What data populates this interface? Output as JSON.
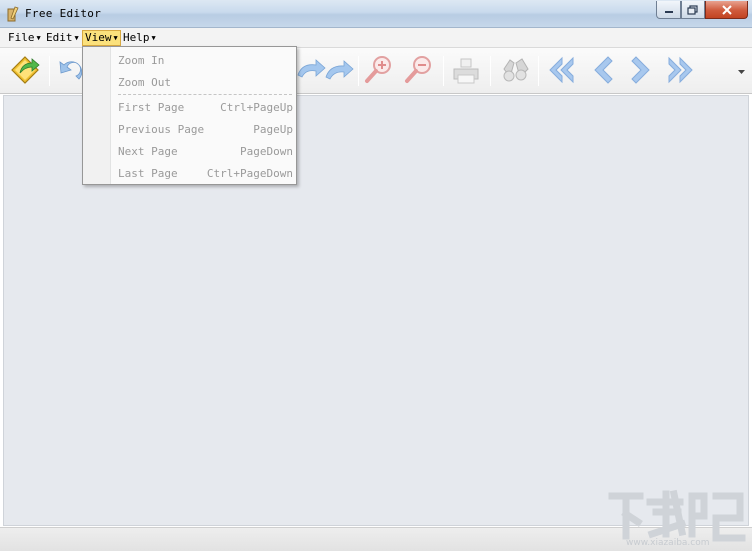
{
  "window": {
    "title": "Free Editor"
  },
  "menubar": {
    "items": [
      {
        "label": "File"
      },
      {
        "label": "Edit"
      },
      {
        "label": "View"
      },
      {
        "label": "Help"
      }
    ]
  },
  "view_menu": {
    "items": [
      {
        "label": "Zoom In",
        "shortcut": ""
      },
      {
        "label": "Zoom Out",
        "shortcut": ""
      },
      {
        "label": "First Page",
        "shortcut": "Ctrl+PageUp"
      },
      {
        "label": "Previous Page",
        "shortcut": "PageUp"
      },
      {
        "label": "Next Page",
        "shortcut": "PageDown"
      },
      {
        "label": "Last Page",
        "shortcut": "Ctrl+PageDown"
      }
    ]
  },
  "toolbar": {
    "icons": [
      "open-icon",
      "undo-icon",
      "redo-icon",
      "zoom-in-icon",
      "zoom-out-icon",
      "print-icon",
      "find-icon",
      "first-page-icon",
      "previous-page-icon",
      "next-page-icon",
      "last-page-icon"
    ]
  },
  "colors": {
    "workspace": "#e6e9ee",
    "menu_active": "#fbe17c",
    "nav_arrow": "#8fb6e6",
    "disabled_text": "#9a9a9a"
  },
  "watermark": {
    "sub": "www.xiazaiba.com"
  }
}
